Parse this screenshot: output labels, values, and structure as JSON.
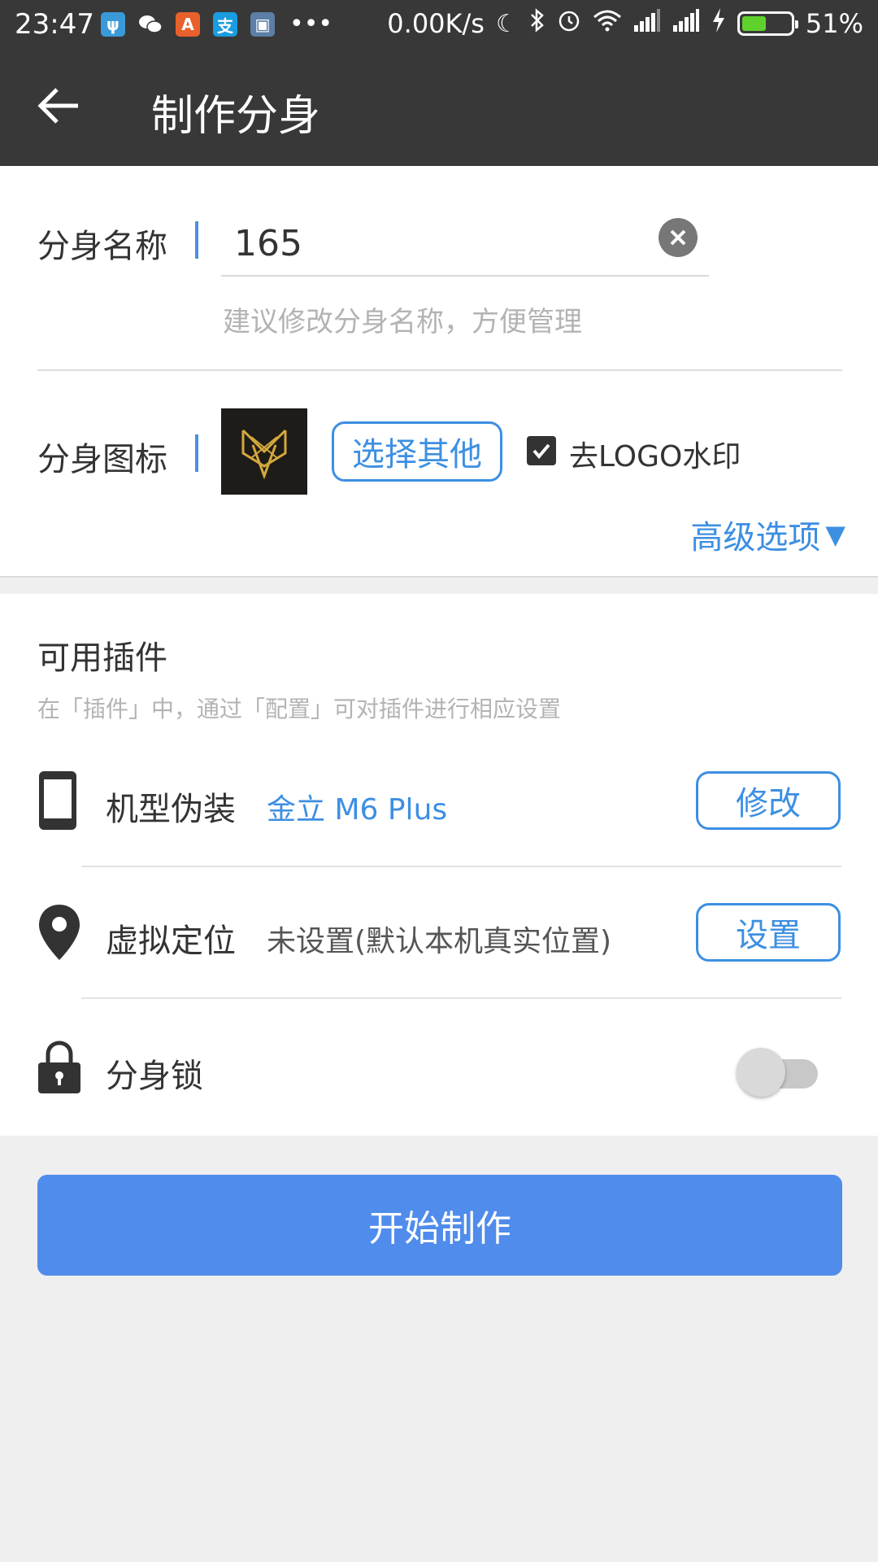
{
  "status_bar": {
    "time": "23:47",
    "net_speed": "0.00K/s",
    "battery_percent": "51%",
    "battery_level": 0.51,
    "left_icons": [
      "usb-icon",
      "wechat-icon",
      "shield-app-icon",
      "alipay-icon",
      "gallery-icon"
    ],
    "right_icons": [
      "moon-icon",
      "bluetooth-icon",
      "alarm-icon",
      "wifi-icon",
      "signal-icon",
      "signal-icon",
      "charging-icon"
    ]
  },
  "toolbar": {
    "title": "制作分身",
    "back_icon": "arrow-left-icon",
    "background": "#383838"
  },
  "clone_name": {
    "label": "分身名称",
    "value": "165",
    "hint": "建议修改分身名称，方便管理"
  },
  "clone_icon": {
    "label": "分身图标",
    "choose_button": "选择其他",
    "remove_logo_label": "去LOGO水印",
    "remove_logo_checked": true,
    "advanced_label": "高级选项",
    "advanced_arrow": "▼"
  },
  "plugins": {
    "title": "可用插件",
    "description": "在「插件」中，通过「配置」可对插件进行相应设置",
    "items": [
      {
        "label": "机型伪装",
        "value": "金立 M6 Plus",
        "button": "修改",
        "icon": "phone-icon"
      },
      {
        "label": "虚拟定位",
        "value": "未设置(默认本机真实位置)",
        "button": "设置",
        "icon": "location-pin-icon"
      },
      {
        "label": "分身锁",
        "icon": "lock-icon",
        "toggle_on": false
      }
    ]
  },
  "primary_button": "开始制作",
  "colors": {
    "accent": "#3d8fe2",
    "primary_button": "#508cec",
    "hint_text": "#b3b3b3",
    "background": "#efefef"
  }
}
